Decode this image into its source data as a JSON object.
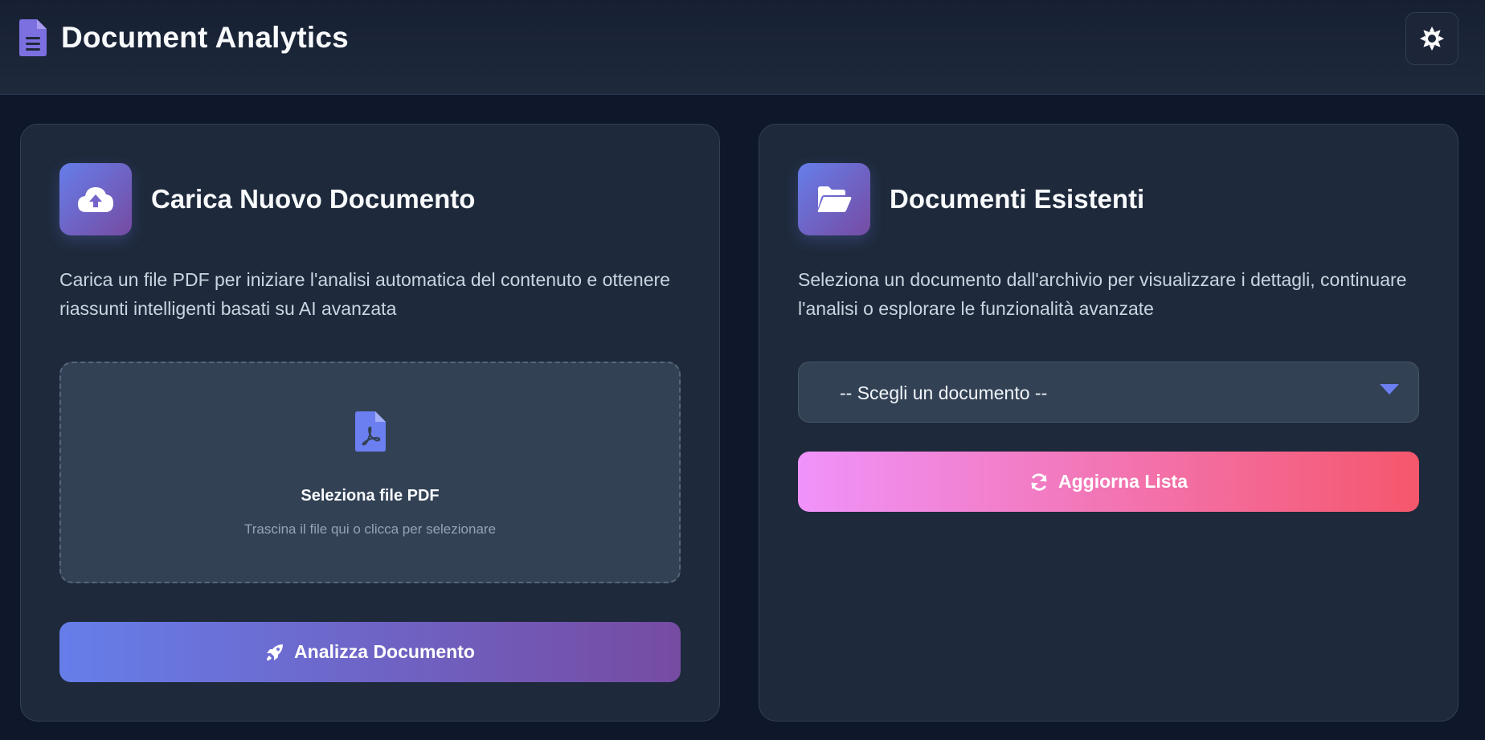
{
  "header": {
    "title": "Document Analytics",
    "brand_icon": "file-lines-icon",
    "theme_toggle_icon": "sun-icon"
  },
  "colors": {
    "background": "#0f172a",
    "card": "#1e293b",
    "primary_gradient": [
      "#667eea",
      "#764ba2"
    ],
    "secondary_gradient": [
      "#f093fb",
      "#f5576c"
    ]
  },
  "upload": {
    "icon": "cloud-upload-icon",
    "title": "Carica Nuovo Documento",
    "description": "Carica un file PDF per iniziare l'analisi automatica del contenuto e ottenere riassunti intelligenti basati su AI avanzata",
    "drop_zone": {
      "icon": "file-pdf-icon",
      "title": "Seleziona file PDF",
      "subtitle": "Trascina il file qui o clicca per selezionare"
    },
    "analyze_button": {
      "icon": "rocket-icon",
      "label": "Analizza Documento"
    }
  },
  "existing": {
    "icon": "folder-open-icon",
    "title": "Documenti Esistenti",
    "description": "Seleziona un documento dall'archivio per visualizzare i dettagli, continuare l'analisi o esplorare le funzionalità avanzate",
    "select": {
      "selected": "-- Scegli un documento --"
    },
    "refresh_button": {
      "icon": "refresh-icon",
      "label": "Aggiorna Lista"
    }
  }
}
